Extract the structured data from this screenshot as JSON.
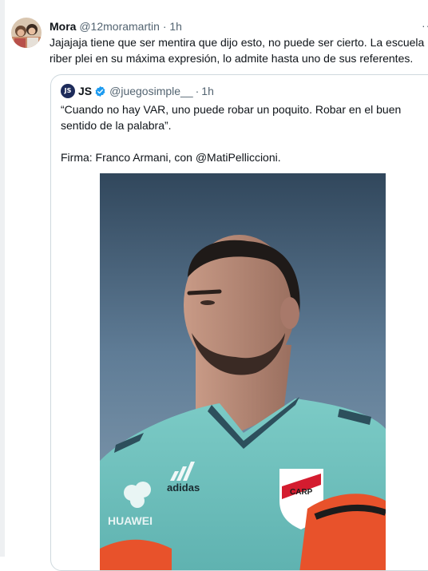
{
  "tweet": {
    "display_name": "Mora",
    "handle": "@12moramartin",
    "separator": "·",
    "time": "1h",
    "more_label": "···",
    "text_line1": "Jajajaja tiene que ser mentira que dijo esto, no puede ser cierto. La escuela",
    "text_line2": "riber plei en su máxima expresión, lo admite hasta uno de sus referentes."
  },
  "quoted_tweet": {
    "avatar_initials": "JS",
    "display_name": "JS",
    "handle": "@juegosimple__",
    "separator": "·",
    "time": "1h",
    "quote_text": "“Cuando no hay VAR, uno puede robar un poquito. Robar en el buen\nsentido de la palabra”.",
    "signature": "Firma: Franco Armani, con @MatiPelliccioni.",
    "verified_color": "#1d9bf0"
  },
  "photo": {
    "sky_color": "#5f7c96",
    "jersey_color": "#7ccbc6",
    "shirt_brand": "adidas",
    "sponsor": "HUAWEI",
    "crest_text": "CARP"
  }
}
